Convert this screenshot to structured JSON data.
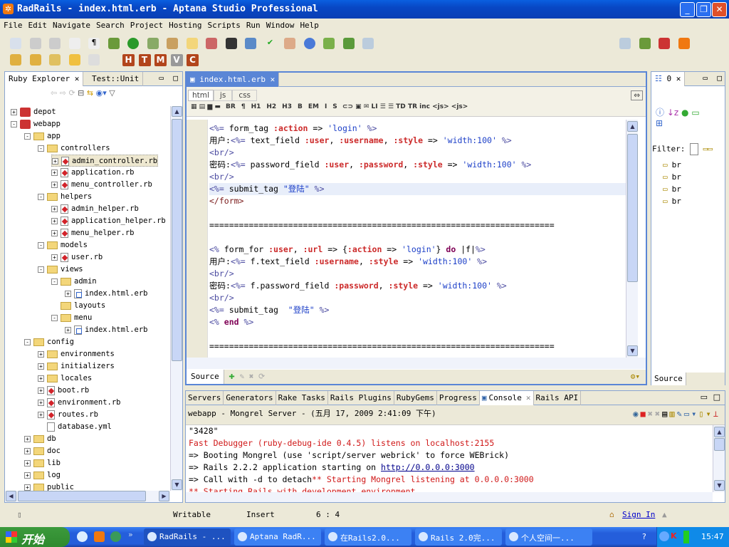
{
  "window": {
    "title": "RadRails - index.html.erb - Aptana Studio Professional",
    "accent": "#0a5fe0"
  },
  "menu": [
    "File",
    "Edit",
    "Navigate",
    "Search",
    "Project",
    "Hosting",
    "Scripts",
    "Run",
    "Window",
    "Help"
  ],
  "toolbar": {
    "html_buttons": [
      "H",
      "T",
      "M",
      "V",
      "C"
    ]
  },
  "explorer": {
    "tabs": [
      "Ruby Explorer",
      "Test::Unit"
    ],
    "tree": [
      {
        "label": "depot",
        "level": 0,
        "type": "project",
        "exp": "+"
      },
      {
        "label": "webapp",
        "level": 0,
        "type": "project",
        "exp": "-"
      },
      {
        "label": "app",
        "level": 1,
        "type": "folder",
        "exp": "-"
      },
      {
        "label": "controllers",
        "level": 2,
        "type": "folder",
        "exp": "-"
      },
      {
        "label": "admin_controller.rb",
        "level": 3,
        "type": "rb",
        "exp": "+",
        "selected": true
      },
      {
        "label": "application.rb",
        "level": 3,
        "type": "rb",
        "exp": "+"
      },
      {
        "label": "menu_controller.rb",
        "level": 3,
        "type": "rb",
        "exp": "+"
      },
      {
        "label": "helpers",
        "level": 2,
        "type": "folder",
        "exp": "-"
      },
      {
        "label": "admin_helper.rb",
        "level": 3,
        "type": "rb",
        "exp": "+"
      },
      {
        "label": "application_helper.rb",
        "level": 3,
        "type": "rb",
        "exp": "+"
      },
      {
        "label": "menu_helper.rb",
        "level": 3,
        "type": "rb",
        "exp": "+"
      },
      {
        "label": "models",
        "level": 2,
        "type": "folder",
        "exp": "-"
      },
      {
        "label": "user.rb",
        "level": 3,
        "type": "rb",
        "exp": "+"
      },
      {
        "label": "views",
        "level": 2,
        "type": "folder",
        "exp": "-"
      },
      {
        "label": "admin",
        "level": 3,
        "type": "folder",
        "exp": "-"
      },
      {
        "label": "index.html.erb",
        "level": 4,
        "type": "erb",
        "exp": "+"
      },
      {
        "label": "layouts",
        "level": 3,
        "type": "folder",
        "exp": ""
      },
      {
        "label": "menu",
        "level": 3,
        "type": "folder",
        "exp": "-"
      },
      {
        "label": "index.html.erb",
        "level": 4,
        "type": "erb",
        "exp": "+"
      },
      {
        "label": "config",
        "level": 1,
        "type": "folder",
        "exp": "-"
      },
      {
        "label": "environments",
        "level": 2,
        "type": "folder",
        "exp": "+"
      },
      {
        "label": "initializers",
        "level": 2,
        "type": "folder",
        "exp": "+"
      },
      {
        "label": "locales",
        "level": 2,
        "type": "folder",
        "exp": "+"
      },
      {
        "label": "boot.rb",
        "level": 2,
        "type": "rb",
        "exp": "+"
      },
      {
        "label": "environment.rb",
        "level": 2,
        "type": "rb",
        "exp": "+"
      },
      {
        "label": "routes.rb",
        "level": 2,
        "type": "rb",
        "exp": "+"
      },
      {
        "label": "database.yml",
        "level": 2,
        "type": "yml",
        "exp": ""
      },
      {
        "label": "db",
        "level": 1,
        "type": "folder",
        "exp": "+"
      },
      {
        "label": "doc",
        "level": 1,
        "type": "folder",
        "exp": "+"
      },
      {
        "label": "lib",
        "level": 1,
        "type": "folder",
        "exp": "+"
      },
      {
        "label": "log",
        "level": 1,
        "type": "folder",
        "exp": "+"
      },
      {
        "label": "public",
        "level": 1,
        "type": "folder",
        "exp": "+"
      }
    ]
  },
  "editor": {
    "tab": "index.html.erb",
    "subtabs": [
      "html",
      "js",
      "css"
    ],
    "format_buttons": [
      "BR",
      "¶",
      "H1",
      "H2",
      "H3",
      "B",
      "EM",
      "I",
      "S"
    ],
    "current_line": 6,
    "lines": [
      [
        [
          "<%= ",
          "g"
        ],
        [
          "form_tag ",
          "t"
        ],
        [
          ":action",
          "s"
        ],
        [
          " => ",
          "t"
        ],
        [
          "'login'",
          "q"
        ],
        [
          " %>",
          "g"
        ]
      ],
      [
        [
          "用户:",
          "t"
        ],
        [
          "<%= ",
          "g"
        ],
        [
          "text_field ",
          "t"
        ],
        [
          ":user",
          "s"
        ],
        [
          ", ",
          "t"
        ],
        [
          ":username",
          "s"
        ],
        [
          ", ",
          "t"
        ],
        [
          ":style",
          "s"
        ],
        [
          " => ",
          "t"
        ],
        [
          "'width:100'",
          "q"
        ],
        [
          " %>",
          "g"
        ]
      ],
      [
        [
          "<br/>",
          "g"
        ]
      ],
      [
        [
          "密码:",
          "t"
        ],
        [
          "<%= ",
          "g"
        ],
        [
          "password_field ",
          "t"
        ],
        [
          ":user",
          "s"
        ],
        [
          ", ",
          "t"
        ],
        [
          ":password",
          "s"
        ],
        [
          ", ",
          "t"
        ],
        [
          ":style",
          "s"
        ],
        [
          " => ",
          "t"
        ],
        [
          "'width:100'",
          "q"
        ],
        [
          " %>",
          "g"
        ]
      ],
      [
        [
          "<br/>",
          "g"
        ]
      ],
      [
        [
          "<%= ",
          "g"
        ],
        [
          "submit_tag ",
          "t"
        ],
        [
          "\"登陆\"",
          "q"
        ],
        [
          " %>",
          "g"
        ]
      ],
      [
        [
          "</form>",
          "tag"
        ]
      ],
      [],
      [
        [
          "======================================================================",
          "t"
        ]
      ],
      [],
      [
        [
          "<% ",
          "g"
        ],
        [
          "form_for ",
          "t"
        ],
        [
          ":user",
          "s"
        ],
        [
          ", ",
          "t"
        ],
        [
          ":url",
          "s"
        ],
        [
          " => {",
          "t"
        ],
        [
          ":action",
          "s"
        ],
        [
          " => ",
          "t"
        ],
        [
          "'login'",
          "q"
        ],
        [
          "} ",
          "t"
        ],
        [
          "do",
          "k"
        ],
        [
          " |f|",
          "t"
        ],
        [
          "%>",
          "g"
        ]
      ],
      [
        [
          "用户:",
          "t"
        ],
        [
          "<%= ",
          "g"
        ],
        [
          "f.text_field ",
          "t"
        ],
        [
          ":username",
          "s"
        ],
        [
          ", ",
          "t"
        ],
        [
          ":style",
          "s"
        ],
        [
          " => ",
          "t"
        ],
        [
          "'width:100'",
          "q"
        ],
        [
          " %>",
          "g"
        ]
      ],
      [
        [
          "<br/>",
          "g"
        ]
      ],
      [
        [
          "密码:",
          "t"
        ],
        [
          "<%= ",
          "g"
        ],
        [
          "f.password_field ",
          "t"
        ],
        [
          ":password",
          "s"
        ],
        [
          ", ",
          "t"
        ],
        [
          ":style",
          "s"
        ],
        [
          " => ",
          "t"
        ],
        [
          "'width:100'",
          "q"
        ],
        [
          " %>",
          "g"
        ]
      ],
      [
        [
          "<br/>",
          "g"
        ]
      ],
      [
        [
          "<%= ",
          "g"
        ],
        [
          "submit_tag  ",
          "t"
        ],
        [
          "\"登陆\"",
          "q"
        ],
        [
          " %>",
          "g"
        ]
      ],
      [
        [
          "<% ",
          "g"
        ],
        [
          "end",
          "k"
        ],
        [
          " %>",
          "g"
        ]
      ],
      [],
      [
        [
          "======================================================================",
          "t"
        ]
      ]
    ],
    "bottom_tab": "Source"
  },
  "outline": {
    "tab": "0",
    "filter_label": "Filter:",
    "items": [
      "br",
      "br",
      "br",
      "br"
    ],
    "bottom_tab": "Source"
  },
  "bottom": {
    "tabs": [
      "Servers",
      "Generators",
      "Rake Tasks",
      "Rails Plugins",
      "RubyGems",
      "Progress",
      "Console",
      "Rails API"
    ],
    "active": "Console",
    "console_title": "webapp - Mongrel Server - (五月 17, 2009 2:41:09 下午)",
    "lines": [
      {
        "text": "\"3428\"",
        "red": false
      },
      {
        "text": "Fast Debugger (ruby-debug-ide 0.4.5) listens on localhost:2155",
        "red": true
      },
      {
        "text": "=> Booting Mongrel (use 'script/server webrick' to force WEBrick)",
        "red": false
      },
      {
        "text": "=> Rails 2.2.2 application starting on ",
        "link": "http://0.0.0.0:3000",
        "red": false
      },
      {
        "text": "=> Call with -d to detach",
        "tail": "** Starting Mongrel listening at 0.0.0.0:3000",
        "red": false
      },
      {
        "text": "** Starting Rails with development environment",
        "red": true
      }
    ]
  },
  "status": {
    "mode": "Writable",
    "insert": "Insert",
    "position": "6 : 4",
    "sign_in": "Sign In"
  },
  "taskbar": {
    "start": "开始",
    "tasks": [
      "RadRails - ...",
      "Aptana RadR...",
      "在Rails2.0...",
      "Rails 2.0完...",
      "个人空间一..."
    ],
    "clock": "15:47"
  }
}
